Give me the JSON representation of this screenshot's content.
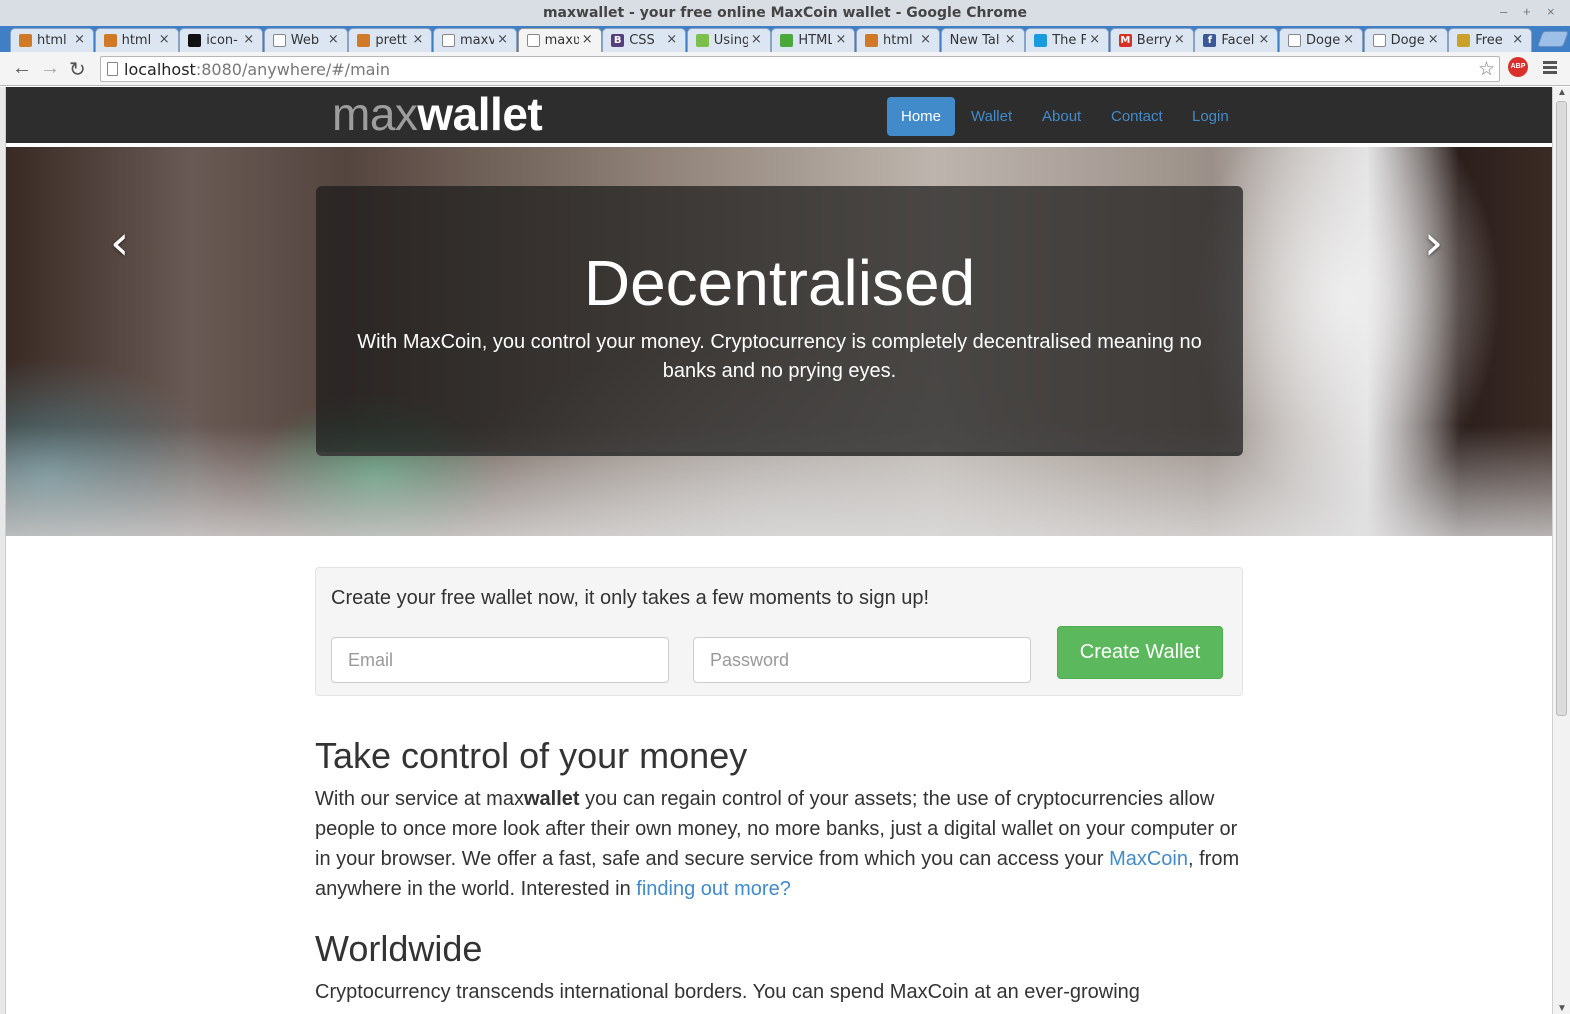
{
  "window": {
    "title": "maxwallet - your free online MaxCoin wallet - Google Chrome",
    "controls": [
      "–",
      "+",
      "×"
    ]
  },
  "tabs": [
    {
      "label": "html",
      "favicon_color": "#d07a28"
    },
    {
      "label": "html",
      "favicon_color": "#d07a28"
    },
    {
      "label": "icon-",
      "favicon_color": "#111111"
    },
    {
      "label": "Web",
      "favicon_color": "#ffffff"
    },
    {
      "label": "prett",
      "favicon_color": "#d07a28"
    },
    {
      "label": "maxv",
      "favicon_color": "#ffffff"
    },
    {
      "label": "maxʋ",
      "favicon_color": "#ffffff"
    },
    {
      "label": "CSS",
      "favicon_color": "#563d7c",
      "favicon_glyph": "B"
    },
    {
      "label": "Using",
      "favicon_color": "#7cbf4c"
    },
    {
      "label": "HTML",
      "favicon_color": "#4ba83a"
    },
    {
      "label": "html",
      "favicon_color": "#d07a28"
    },
    {
      "label": "New Tal",
      "favicon_color": ""
    },
    {
      "label": "The F",
      "favicon_color": "#1a9be0"
    },
    {
      "label": "Berry",
      "favicon_color": "#d93025",
      "favicon_glyph": "M"
    },
    {
      "label": "Facel",
      "favicon_color": "#3b5998",
      "favicon_glyph": "f"
    },
    {
      "label": "Doge",
      "favicon_color": "#ffffff"
    },
    {
      "label": "Doge",
      "favicon_color": "#ffffff"
    },
    {
      "label": "Free",
      "favicon_color": "#c9a227"
    }
  ],
  "active_tab_index": 6,
  "toolbar": {
    "back_icon": "←",
    "forward_icon": "→",
    "reload_icon": "↻",
    "url_host": "localhost",
    "url_rest": ":8080/anywhere/#/main",
    "star_icon": "☆",
    "abp_label": "ABP"
  },
  "site": {
    "brand_light": "max",
    "brand_bold": "wallet",
    "nav": [
      {
        "label": "Home",
        "active": true
      },
      {
        "label": "Wallet",
        "active": false
      },
      {
        "label": "About",
        "active": false
      },
      {
        "label": "Contact",
        "active": false
      },
      {
        "label": "Login",
        "active": false
      }
    ],
    "carousel": {
      "prev": "‹",
      "next": "›",
      "heading": "Decentralised",
      "text": "With MaxCoin, you control your money. Cryptocurrency is completely decentralised meaning no banks and no prying eyes."
    },
    "signup": {
      "lead": "Create your free wallet now, it only takes a few moments to sign up!",
      "email_placeholder": "Email",
      "password_placeholder": "Password",
      "button": "Create Wallet"
    },
    "section1": {
      "heading": "Take control of your money",
      "p_before": "With our service at max",
      "p_bold": "wallet",
      "p_mid": " you can regain control of your assets; the use of cryptocurrencies allow people to once more look after their own money, no more banks, just a digital wallet on your computer or in your browser. We offer a fast, safe and secure service from which you can access your ",
      "link1": "MaxCoin",
      "p_after": ", from anywhere in the world. Interested in ",
      "link2": "finding out more?"
    },
    "section2": {
      "heading": "Worldwide",
      "text": "Cryptocurrency transcends international borders. You can spend MaxCoin at an ever-growing"
    }
  },
  "colors": {
    "accent": "#428bca",
    "success": "#5cb85c",
    "navbar_bg": "#2d2d2d"
  }
}
